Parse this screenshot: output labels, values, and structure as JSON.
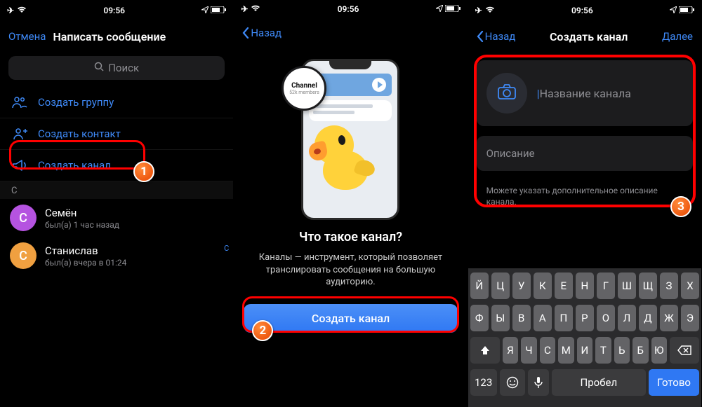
{
  "status": {
    "time": "09:56"
  },
  "screen1": {
    "cancel": "Отмена",
    "title": "Написать сообщение",
    "search_placeholder": "Поиск",
    "actions": {
      "group": "Создать группу",
      "contact": "Создать контакт",
      "channel": "Создать канал"
    },
    "section": "С",
    "contacts": [
      {
        "name": "Семён",
        "sub": "был(а) 1 час назад",
        "initial": "С",
        "color": "#b553e0"
      },
      {
        "name": "Станислав",
        "sub": "был(а) вчера в 01:24",
        "initial": "С",
        "color": "#f0a040"
      }
    ],
    "index_letter": "С",
    "step": "1"
  },
  "screen2": {
    "back": "Назад",
    "badge_title": "Channel",
    "badge_sub": "52k members",
    "promo_title": "Что такое канал?",
    "promo_desc": "Каналы — инструмент, который позволяет транслировать сообщения на большую аудиторию.",
    "button": "Создать канал",
    "step": "2"
  },
  "screen3": {
    "back": "Назад",
    "title": "Создать канал",
    "next": "Далее",
    "name_placeholder": "Название канала",
    "desc_placeholder": "Описание",
    "hint": "Можете указать дополнительное описание канала.",
    "step": "3",
    "keyboard": {
      "row1": [
        "Й",
        "Ц",
        "У",
        "К",
        "Е",
        "Н",
        "Г",
        "Ш",
        "Щ",
        "З",
        "Х"
      ],
      "row2": [
        "Ф",
        "Ы",
        "В",
        "А",
        "П",
        "Р",
        "О",
        "Л",
        "Д",
        "Ж",
        "Э"
      ],
      "row3": [
        "Я",
        "Ч",
        "С",
        "М",
        "И",
        "Т",
        "Ь",
        "Б",
        "Ю"
      ],
      "nums": "123",
      "space": "Пробел",
      "done": "Готово"
    }
  }
}
